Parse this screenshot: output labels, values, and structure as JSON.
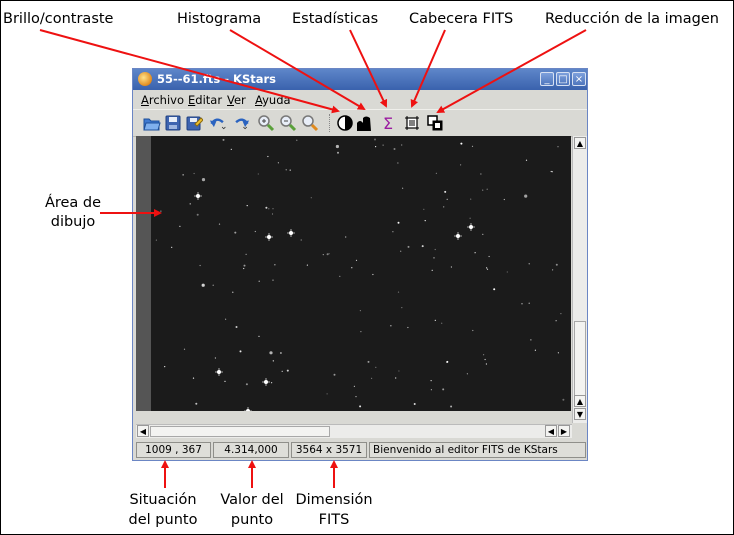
{
  "annotations": {
    "brightness": "Brillo/contraste",
    "histogram": "Histograma",
    "statistics": "Estadísticas",
    "fits_header": "Cabecera FITS",
    "image_reduction": "Reducción de la imagen",
    "drawing_area_line1": "Área de",
    "drawing_area_line2": "dibujo",
    "pixel_position_line1": "Situación",
    "pixel_position_line2": "del punto",
    "pixel_value_line1": "Valor del",
    "pixel_value_line2": "punto",
    "fits_dimension_line1": "Dimensión",
    "fits_dimension_line2": "FITS"
  },
  "window": {
    "title": "55--61.fts - KStars",
    "buttons": [
      "_",
      "□",
      "×"
    ]
  },
  "menu": [
    "Archivo",
    "Editar",
    "Ver",
    "Ayuda"
  ],
  "toolbar_icons": [
    "open-icon",
    "save-icon",
    "save-as-icon",
    "undo-icon",
    "redo-icon",
    "zoom-in-icon",
    "zoom-out-icon",
    "zoom-default-icon",
    "brightness-contrast-icon",
    "histogram-icon",
    "statistics-icon",
    "fits-header-icon",
    "image-reduction-icon"
  ],
  "status": {
    "position": "1009 , 367",
    "value": "4.314,000",
    "dimension": "3564 x 3571",
    "message": "Bienvenido al editor FITS de KStars"
  },
  "colors": {
    "annotation_arrow": "#ee1111",
    "titlebar": "#4a72b8",
    "canvas": "#1b1b1b"
  }
}
